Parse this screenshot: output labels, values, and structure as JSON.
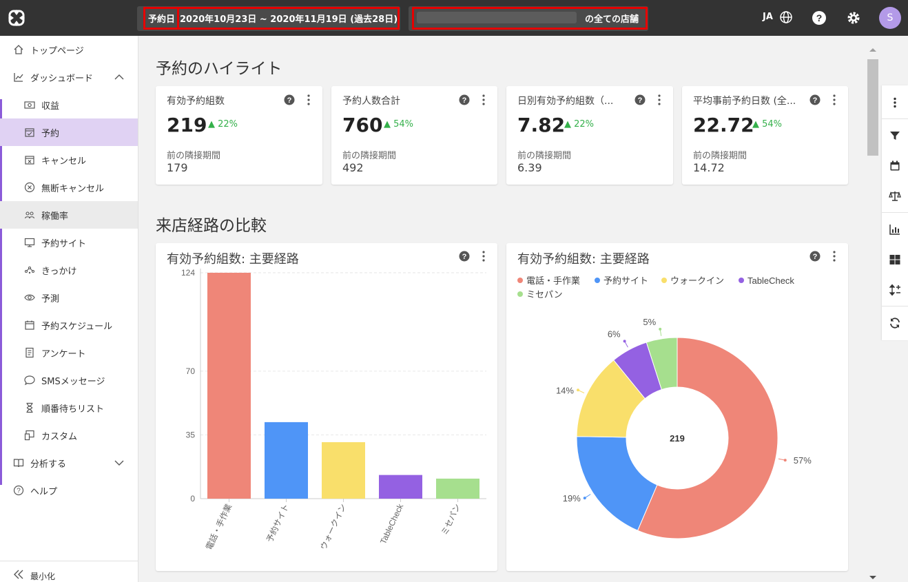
{
  "topbar": {
    "date_label": "予約日",
    "date_value": "2020年10月23日 ~ 2020年11月19日 (過去28日)",
    "store_value": "の全ての店舗",
    "lang": "JA",
    "avatar_initial": "S"
  },
  "sidebar": {
    "items": [
      {
        "label": "トップページ",
        "icon": "home-icon"
      },
      {
        "label": "ダッシュボード",
        "icon": "chart-line-icon"
      },
      {
        "label": "収益",
        "icon": "money-icon"
      },
      {
        "label": "予約",
        "icon": "calendar-check-icon"
      },
      {
        "label": "キャンセル",
        "icon": "calendar-x-icon"
      },
      {
        "label": "無断キャンセル",
        "icon": "circle-x-icon"
      },
      {
        "label": "稼働率",
        "icon": "people-icon"
      },
      {
        "label": "予約サイト",
        "icon": "monitor-icon"
      },
      {
        "label": "きっかけ",
        "icon": "network-icon"
      },
      {
        "label": "予測",
        "icon": "eye-icon"
      },
      {
        "label": "予約スケジュール",
        "icon": "calendar-icon"
      },
      {
        "label": "アンケート",
        "icon": "document-icon"
      },
      {
        "label": "SMSメッセージ",
        "icon": "chat-icon"
      },
      {
        "label": "順番待ちリスト",
        "icon": "hourglass-icon"
      },
      {
        "label": "カスタム",
        "icon": "custom-icon"
      },
      {
        "label": "分析する",
        "icon": "book-icon"
      },
      {
        "label": "ヘルプ",
        "icon": "help-circle-icon"
      }
    ],
    "minimize_label": "最小化"
  },
  "highlights": {
    "title": "予約のハイライト",
    "prev_label": "前の隣接期間",
    "cards": [
      {
        "title": "有効予約組数",
        "value": "219",
        "delta": "22%",
        "prev": "179"
      },
      {
        "title": "予約人数合計",
        "value": "760",
        "delta": "54%",
        "prev": "492"
      },
      {
        "title": "日別有効予約組数（...",
        "value": "7.82",
        "delta": "22%",
        "prev": "6.39"
      },
      {
        "title": "平均事前予約日数 (全...",
        "value": "22.72",
        "delta": "54%",
        "prev": "14.72"
      }
    ]
  },
  "compare": {
    "title": "来店経路の比較",
    "bar_card_title": "有効予約組数: 主要経路",
    "pie_card_title": "有効予約組数: 主要経路",
    "pie_center": "219"
  },
  "colors": {
    "phone": "#ef8678",
    "site": "#4f95f7",
    "walkin": "#f9df6b",
    "tablecheck": "#9461e2",
    "misepan": "#a6df8e",
    "accent": "#8b5bd9",
    "positive": "#34b04a"
  },
  "chart_data": [
    {
      "type": "bar",
      "title": "有効予約組数: 主要経路",
      "categories": [
        "電話・手作業",
        "予約サイト",
        "ウォークイン",
        "TableCheck",
        "ミセパン"
      ],
      "values": [
        124,
        42,
        31,
        13,
        11
      ],
      "yticks": [
        0,
        35,
        70,
        124
      ],
      "ylim": [
        0,
        124
      ]
    },
    {
      "type": "pie",
      "title": "有効予約組数: 主要経路",
      "labels": [
        "電話・手作業",
        "予約サイト",
        "ウォークイン",
        "TableCheck",
        "ミセパン"
      ],
      "percentages": [
        57,
        19,
        14,
        6,
        5
      ],
      "percent_labels": [
        "57%",
        "19%",
        "14%",
        "6%",
        "5%"
      ],
      "center_value": "219",
      "legend": "top"
    }
  ]
}
